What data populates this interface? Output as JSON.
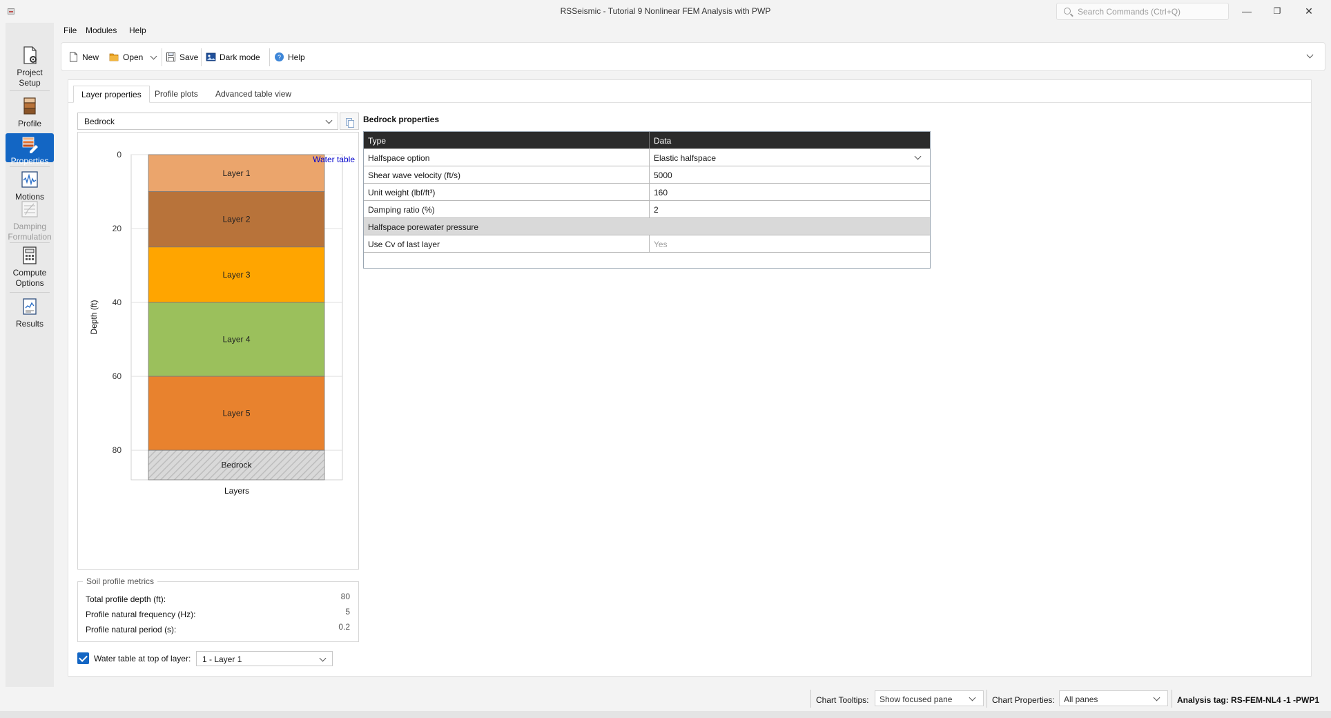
{
  "window": {
    "title": "RSSeismic - Tutorial 9 Nonlinear FEM Analysis with PWP",
    "search_placeholder": "Search Commands (Ctrl+Q)",
    "minimize": "—",
    "restore": "❐",
    "close": "✕"
  },
  "sidebar": {
    "items": [
      {
        "label_1": "Project",
        "label_2": "Setup",
        "icon": "project-setup-icon"
      },
      {
        "label_1": "Profile",
        "icon": "profile-icon"
      },
      {
        "label_1": "Properties",
        "icon": "properties-icon",
        "active": true
      },
      {
        "label_1": "Motions",
        "icon": "motions-icon"
      },
      {
        "label_1": "Damping",
        "label_2": "Formulation",
        "icon": "damping-icon",
        "disabled": true
      },
      {
        "label_1": "Compute",
        "label_2": "Options",
        "icon": "compute-icon"
      },
      {
        "label_1": "Results",
        "icon": "results-icon"
      }
    ]
  },
  "menubar": [
    "File",
    "Modules",
    "Help"
  ],
  "toolbar": {
    "new": "New",
    "open": "Open",
    "save": "Save",
    "dark_mode": "Dark mode",
    "help": "Help"
  },
  "tabs": [
    "Layer properties",
    "Profile plots",
    "Advanced table view"
  ],
  "layer_select": {
    "value": "Bedrock"
  },
  "chart_data": {
    "type": "bar",
    "ylabel": "Depth (ft)",
    "xlabel": "Layers",
    "yticks": [
      0,
      20,
      40,
      60,
      80
    ],
    "ylim": [
      0,
      88
    ],
    "water_table_label": "Water table",
    "layers": [
      {
        "name": "Layer 1",
        "top": 0,
        "bottom": 10,
        "color": "#EBA56C"
      },
      {
        "name": "Layer 2",
        "top": 10,
        "bottom": 25,
        "color": "#B8733A"
      },
      {
        "name": "Layer 3",
        "top": 25,
        "bottom": 40,
        "color": "#FFA500"
      },
      {
        "name": "Layer 4",
        "top": 40,
        "bottom": 60,
        "color": "#9BC05C"
      },
      {
        "name": "Layer 5",
        "top": 60,
        "bottom": 80,
        "color": "#E8822E"
      },
      {
        "name": "Bedrock",
        "top": 80,
        "bottom": 88,
        "color": "#D9D9D9",
        "hatched": true
      }
    ]
  },
  "metrics": {
    "legend": "Soil profile metrics",
    "rows": [
      {
        "label": "Total profile depth (ft):",
        "value": "80"
      },
      {
        "label": "Profile natural frequency (Hz):",
        "value": "5"
      },
      {
        "label": "Profile natural period (s):",
        "value": "0.2"
      }
    ]
  },
  "water_table": {
    "checked": true,
    "label": "Water table at top of layer:",
    "value": "1 - Layer 1"
  },
  "properties": {
    "title": "Bedrock properties",
    "head": {
      "type": "Type",
      "data": "Data"
    },
    "rows": [
      {
        "type": "Halfspace option",
        "data": "Elastic halfspace",
        "dropdown": true
      },
      {
        "type": "Shear wave velocity (ft/s)",
        "data": "5000"
      },
      {
        "type": "Unit weight (lbf/ft³)",
        "data": "160"
      },
      {
        "type": "Damping ratio (%)",
        "data": "2"
      },
      {
        "group": "Halfspace porewater pressure"
      },
      {
        "type": "Use Cv of last layer",
        "data": "Yes",
        "muted": true
      }
    ]
  },
  "statusbar": {
    "tooltips_label": "Chart Tooltips:",
    "tooltips_value": "Show focused pane",
    "properties_label": "Chart Properties:",
    "properties_value": "All panes",
    "analysis_tag": "Analysis tag: RS-FEM-NL4 -1 -PWP1"
  },
  "colors": {
    "accent": "#1366C4",
    "header": "#2B2B2B",
    "water_table": "#0000CC"
  }
}
